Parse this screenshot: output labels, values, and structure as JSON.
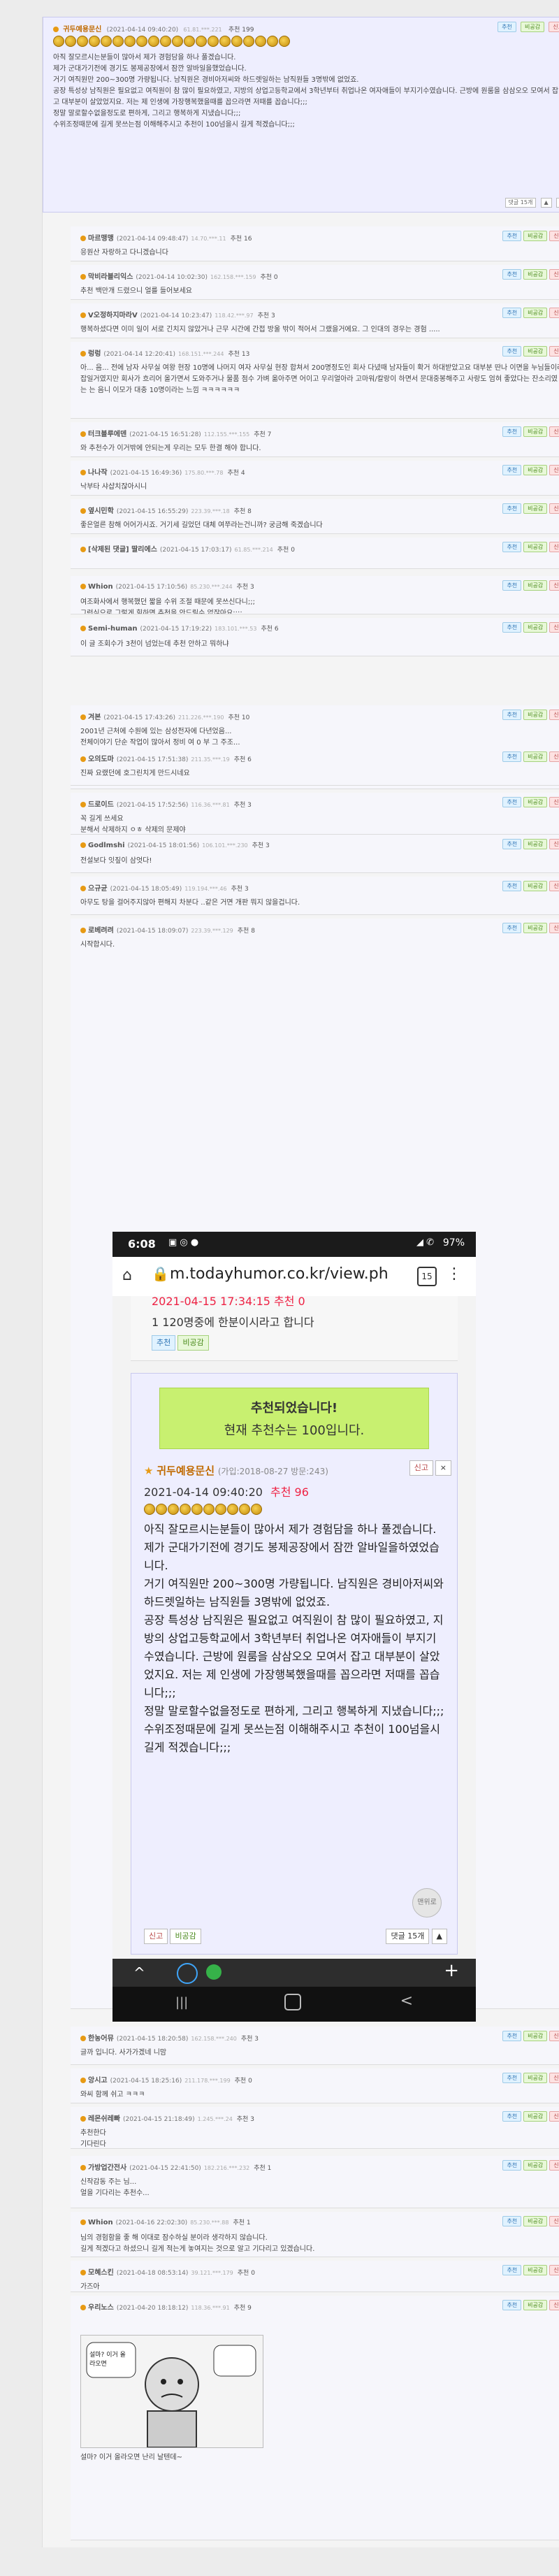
{
  "comments": [
    {
      "nick": "귀두예용문신",
      "date": "(2021-04-14 09:40:20)",
      "ip": "61.81.***.221",
      "rec_label": "추천 199",
      "medals": 20,
      "text": "아직 잘모르시는분들이 많아서 제가 경험담을 하나 풀겠습니다.\n제가 군대가기전에 경기도 봉제공장에서 잠깐 알바일을했었습니다.\n거기 여직원만 200~300명 가량됩니다. 남직원은 경비아저씨와 하드렛일하는 남직원들 3명밖에 없었죠.\n공장 특성상 남직원은 필요없고 여직원이 참 많이 필요하였고, 지방의 상업고등학교에서 3학년부터 취업나온 여자애들이 부지기수였습니다. 근방에 원룸을 삼삼오오 모여서 잡고 대부분이 살았었지요. 저는 제 인생에 가장행복했을때를 꼽으라면 저때를 꼽습니다;;;\n정말 말로할수없을정도로 편하게, 그리고 행복하게 지냈습니다;;;\n수위조정때문에 길게 못쓰는점 이해해주시고 추천이 100넘을시 길게 적겠습니다;;;",
      "reply_count": "댓글 15개"
    }
  ],
  "replies": [
    {
      "nick": "마르맹맹",
      "date": "(2021-04-14 09:48:47)",
      "ip": "14.70.***.11",
      "rec": "추천 16",
      "text": "응원산 자랑하고 다니겠습니다"
    },
    {
      "nick": "막비라블리익스",
      "date": "(2021-04-14 10:02:30)",
      "ip": "162.158.***.159",
      "rec": "추천 0",
      "text": "추천 백만개 드렸으니 얼를 들어보세요"
    },
    {
      "nick": "V오정하지마라V",
      "date": "(2021-04-14 10:23:47)",
      "ip": "118.42.***.97",
      "rec": "추천 3",
      "text": "행복하셨다면 이미 일이 서로 긴치지 않았거나 근무 시간에 간접 방울 밖이 적어서 그랬을거에요. 그 인대의 경우는 경험 ....."
    },
    {
      "nick": "렁렁",
      "date": "(2021-04-14 12:20:41)",
      "ip": "168.151.***.244",
      "rec": "추천 13",
      "text": "아... 음... 전에 남자 사무실 여왕 현장 10명에 나머지 여자 사무실 현장 합쳐서 200명정도인 회사 다녔때 남자들이 확거 하대받았고요 대부분 딴나 이면을 누님들이라 잡일거였지만 회사가 흐리어 올가면서 도와주거나 물품 점수 가벼 옮아주면 어이고 우리얼아라 고마워/칼랑이 하면서 문대중봉해주고 사랑도 엄혀 좋았다는 잔소리였는 는 음니 이모가 대충 10명이라는 느낌 ㅋㅋㅋㅋㅋㅋ"
    },
    {
      "nick": "터크블루에덴",
      "date": "(2021-04-15 16:51:28)",
      "ip": "112.155.***.155",
      "rec": "추천 7",
      "text": "와 추천수가 이거밖에 안되는게 우리는 모두 한결 해야 합니다."
    },
    {
      "nick": "나나작",
      "date": "(2021-04-15 16:49:36)",
      "ip": "175.80.***.78",
      "rec": "추천 4",
      "text": "낙부타 샤샵치잖아시니"
    },
    {
      "nick": "옆시민학",
      "date": "(2021-04-15 16:55:29)",
      "ip": "223.39.***.18",
      "rec": "추천 8",
      "text": "좋은얼른 참해 어어가시죠. 거기세 길었던 대체 여쭈라는건니까? 궁금해 죽겠습니다"
    },
    {
      "nick": "[삭제된 댓글] 딸리에스",
      "date": "(2021-04-15 17:03:17)",
      "ip": "61.85.***.214",
      "rec": "추천 0",
      "text": ""
    },
    {
      "nick": "Whion",
      "date": "(2021-04-15 17:10:56)",
      "ip": "85.230.***.244",
      "rec": "추천 3",
      "text": "여조화사에서 행복했던 짧을 수위 조절 때문에 못쓰신다니;;;\n그런식으로 그렇게 힘하면 추천을 안드릴수 없잖아요;;;;"
    },
    {
      "nick": "Semi-human",
      "date": "(2021-04-15 17:19:22)",
      "ip": "183.101.***.53",
      "rec": "추천 6",
      "text": "이 글 조회수가 3천이 넘었는데 추천 안하고 뭐하냐"
    },
    {
      "nick": "겨본",
      "date": "(2021-04-15 17:43:26)",
      "ip": "211.226.***.190",
      "rec": "추천 10",
      "text": "2001년 근처에 수원에 있는 삼성전자에 다년었음...\n전체이야기 단순 작업이 많아서 정비 여 0 부 그 주조...\n특히나 삼업계쪽 사람들이 많아 여자... 관리직을 제외하고 10대 후반~20대 초반이 대부분이였죠...\n10대 후반부터 월급 2~300만원 정도 받으니... 빈진 대부이죠 ;;; 여자고 남자고 참을 행판하게 펼쳐요 ;;;"
    },
    {
      "nick": "오의도마",
      "date": "(2021-04-15 17:51:38)",
      "ip": "211.35.***.19",
      "rec": "추천 6",
      "text": "진짜 요랬던에 호그린치게 만드시네요"
    },
    {
      "nick": "드로이드",
      "date": "(2021-04-15 17:52:56)",
      "ip": "116.36.***.81",
      "rec": "추천 3",
      "text": "꼭 길게 쓰세요\n분해서 삭제하지 ㅇㅎ 삭제의 문제야"
    },
    {
      "nick": "Godlmshi",
      "date": "(2021-04-15 18:01:56)",
      "ip": "106.101.***.230",
      "rec": "추천 3",
      "text": "전설보다 잇짚이 삼엇다!"
    },
    {
      "nick": "으규균",
      "date": "(2021-04-15 18:05:49)",
      "ip": "119.194.***.46",
      "rec": "추천 3",
      "text": "아무도 탕을 걸어주지않아 편해지 차분다 ..같은 거면 개판 뭐지 않을겁니다."
    },
    {
      "nick": "로베려려",
      "date": "(2021-04-15 18:09:07)",
      "ip": "223.39.***.129",
      "rec": "추천 8",
      "text": "시작합시다."
    }
  ],
  "phone": {
    "time": "6:08",
    "battery": "97%",
    "url": "m.todayhumor.co.kr/view.ph",
    "tab_count": "15",
    "prev_date": "2021-04-15 17:34:15 추천 0",
    "prev_text": "1 120명중에 한분이시라고 합니다",
    "up_btn": "추천",
    "down_btn": "비공감",
    "banner_line1": "추천되었습니다!",
    "banner_line2": "현재 추천수는 100입니다.",
    "report_btn": "신고",
    "close_btn": "×",
    "card_nick": "귀두예용문신",
    "card_joined": "(가입:2018-08-27 방문:243)",
    "card_date": "2021-04-14 09:40:20",
    "card_rec": "추천 96",
    "card_text": "아직 잘모르시는분들이 많아서 제가 경험담을 하나 풀겠습니다.\n제가 군대가기전에 경기도 봉제공장에서 잠깐 알바일을하였었습니다.\n거기 여직원만 200~300명 가량됩니다. 남직원은 경비아저씨와 하드렛일하는 남직원들 3명밖에 없었죠.\n공장 특성상 남직원은 필요없고 여직원이 참 많이 필요하였고, 지방의 상업고등학교에서 3학년부터 취업나온 여자애들이 부지기수였습니다. 근방에 원룸을 삼삼오오 모여서 잡고 대부분이 살았었지요. 저는 제 인생에 가장행복했을때를 꼽으라면 저때를 꼽습니다;;;\n정말 말로할수없을정도로 편하게, 그리고 행복하게 지냈습니다;;;\n수위조정때문에 길게 못쓰는점 이해해주시고 추천이 100넘을시 길게 적겠습니다;;;",
    "card_reply_btn": "댓글 15개",
    "card_del_btn": "비공감",
    "scroll_label": "맨위로",
    "nav_back": "<",
    "nav_plus": "+"
  },
  "replies2": [
    {
      "nick": "한농어뮤",
      "date": "(2021-04-15 18:20:58)",
      "ip": "162.158.***.240",
      "rec": "추천 3",
      "text": "글까 입니다. 사가가겠네 니맘"
    },
    {
      "nick": "앙시고",
      "date": "(2021-04-15 18:25:16)",
      "ip": "211.178.***.199",
      "rec": "추천 0",
      "text": "와씨 함께 쉬고 ㅋㅋㅋ"
    },
    {
      "nick": "레몬쉬레빠",
      "date": "(2021-04-15 21:18:49)",
      "ip": "1.245.***.24",
      "rec": "추천 3",
      "text": "추천한다\n기다린다"
    },
    {
      "nick": "가방업간전사",
      "date": "(2021-04-15 22:41:50)",
      "ip": "182.216.***.232",
      "rec": "추천 1",
      "text": "신작감동 주는 님...\n얼을 기다리는 추천수...\n\nㅋㅋㅋㅋㅋㅋㅋㅋㅋㅋ"
    },
    {
      "nick": "Whion",
      "date": "(2021-04-16 22:02:30)",
      "ip": "85.230.***.88",
      "rec": "추천 1",
      "text": "님의 경험함을 좋 해 이대로 잠수하실 분이라 생각하지 않습니다.\n길게 적겠다고 하셨으니 길게 적는게 놓여지는 것으로 알고 기다리고 있겠습니다."
    },
    {
      "nick": "모혜스킨",
      "date": "(2021-04-18 08:53:14)",
      "ip": "39.121.***.179",
      "rec": "추천 0",
      "text": "가즈아"
    },
    {
      "nick": "우리노스",
      "date": "(2021-04-20 18:18:12)",
      "ip": "118.36.***.91",
      "rec": "추천 9",
      "text": "설마? 이거 올라오면 난리 날텐데~"
    }
  ],
  "cartoon_text": "설마? 이거 올라오면",
  "buttons": {
    "up": "추천",
    "down": "비공감",
    "report": "신고"
  },
  "main_pager": {
    "reply": "댓글 15개",
    "prev": "▲",
    "next": "▼"
  }
}
